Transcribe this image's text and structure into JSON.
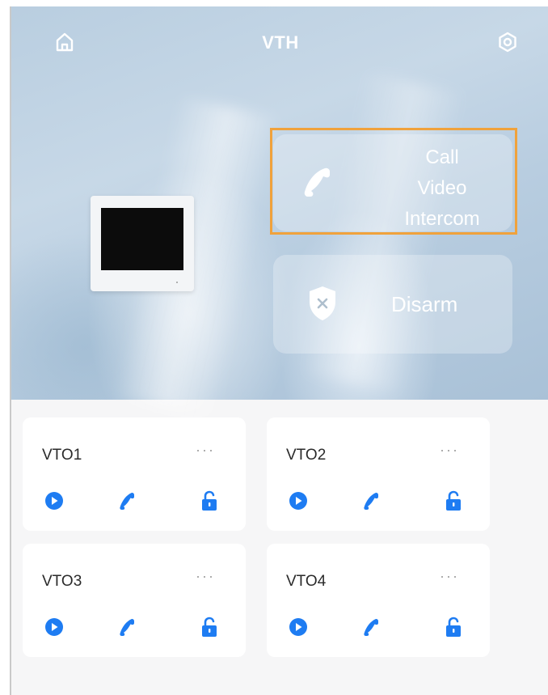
{
  "header": {
    "title": "VTH",
    "home_icon": "home-icon",
    "settings_icon": "settings-icon"
  },
  "hero": {
    "call_button": {
      "lines": [
        "Call",
        "Video",
        "Intercom"
      ],
      "icon": "phone-icon"
    },
    "disarm_button": {
      "label": "Disarm",
      "icon": "shield-x-icon"
    }
  },
  "devices": [
    {
      "name": "VTO1",
      "more": "···"
    },
    {
      "name": "VTO2",
      "more": "···"
    },
    {
      "name": "VTO3",
      "more": "···"
    },
    {
      "name": "VTO4",
      "more": "···"
    }
  ],
  "card_actions": [
    "play-icon",
    "phone-icon",
    "unlock-icon"
  ],
  "colors": {
    "accent": "#1e7cf2",
    "highlight": "#f0a23c"
  }
}
